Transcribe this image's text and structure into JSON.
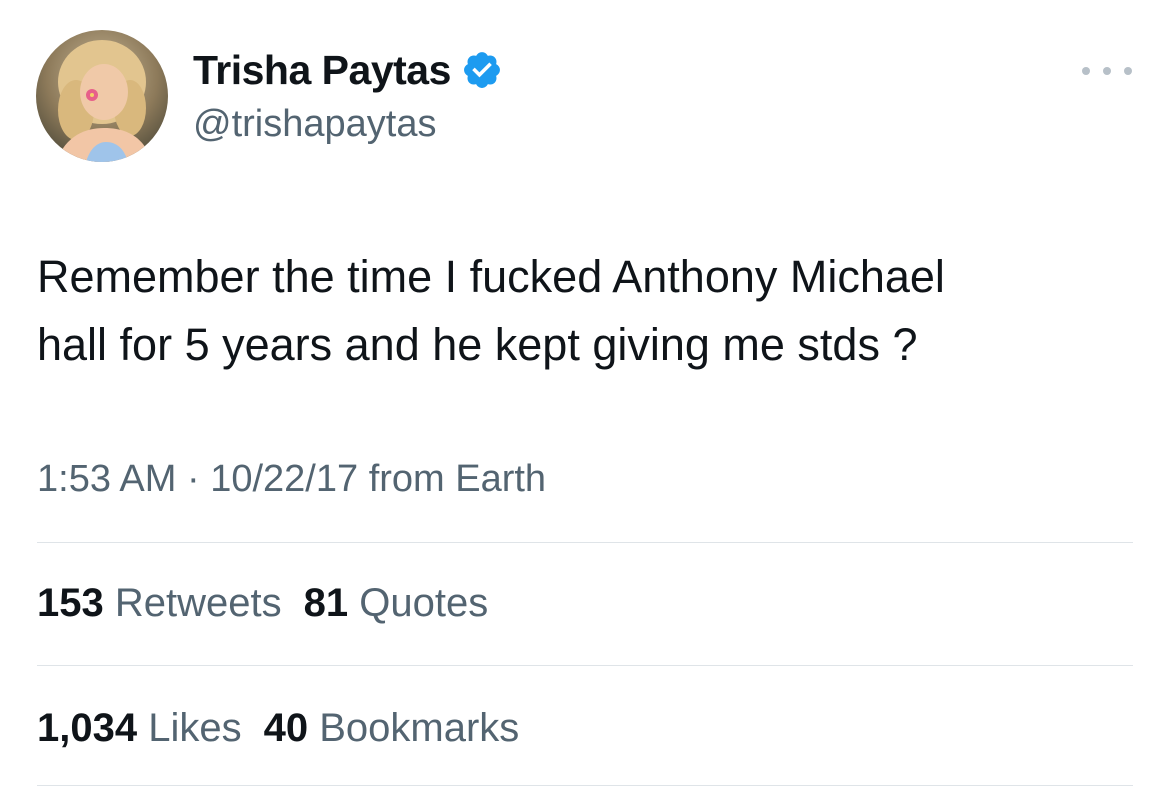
{
  "author": {
    "display_name": "Trisha Paytas",
    "handle": "@trishapaytas",
    "verified": true,
    "verified_color": "#1d9bf0"
  },
  "tweet": {
    "line1": "Remember the time I fucked Anthony Michael",
    "line2": "hall for 5 years and he kept giving me stds ?",
    "time": "1:53 AM",
    "separator": "·",
    "date": "10/22/17",
    "source": "from Earth"
  },
  "stats": {
    "retweets_count": "153",
    "retweets_label": "Retweets",
    "quotes_count": "81",
    "quotes_label": "Quotes",
    "likes_count": "1,034",
    "likes_label": "Likes",
    "bookmarks_count": "40",
    "bookmarks_label": "Bookmarks"
  },
  "icons": {
    "more": "more-options-icon",
    "verified": "verified-badge-icon"
  }
}
